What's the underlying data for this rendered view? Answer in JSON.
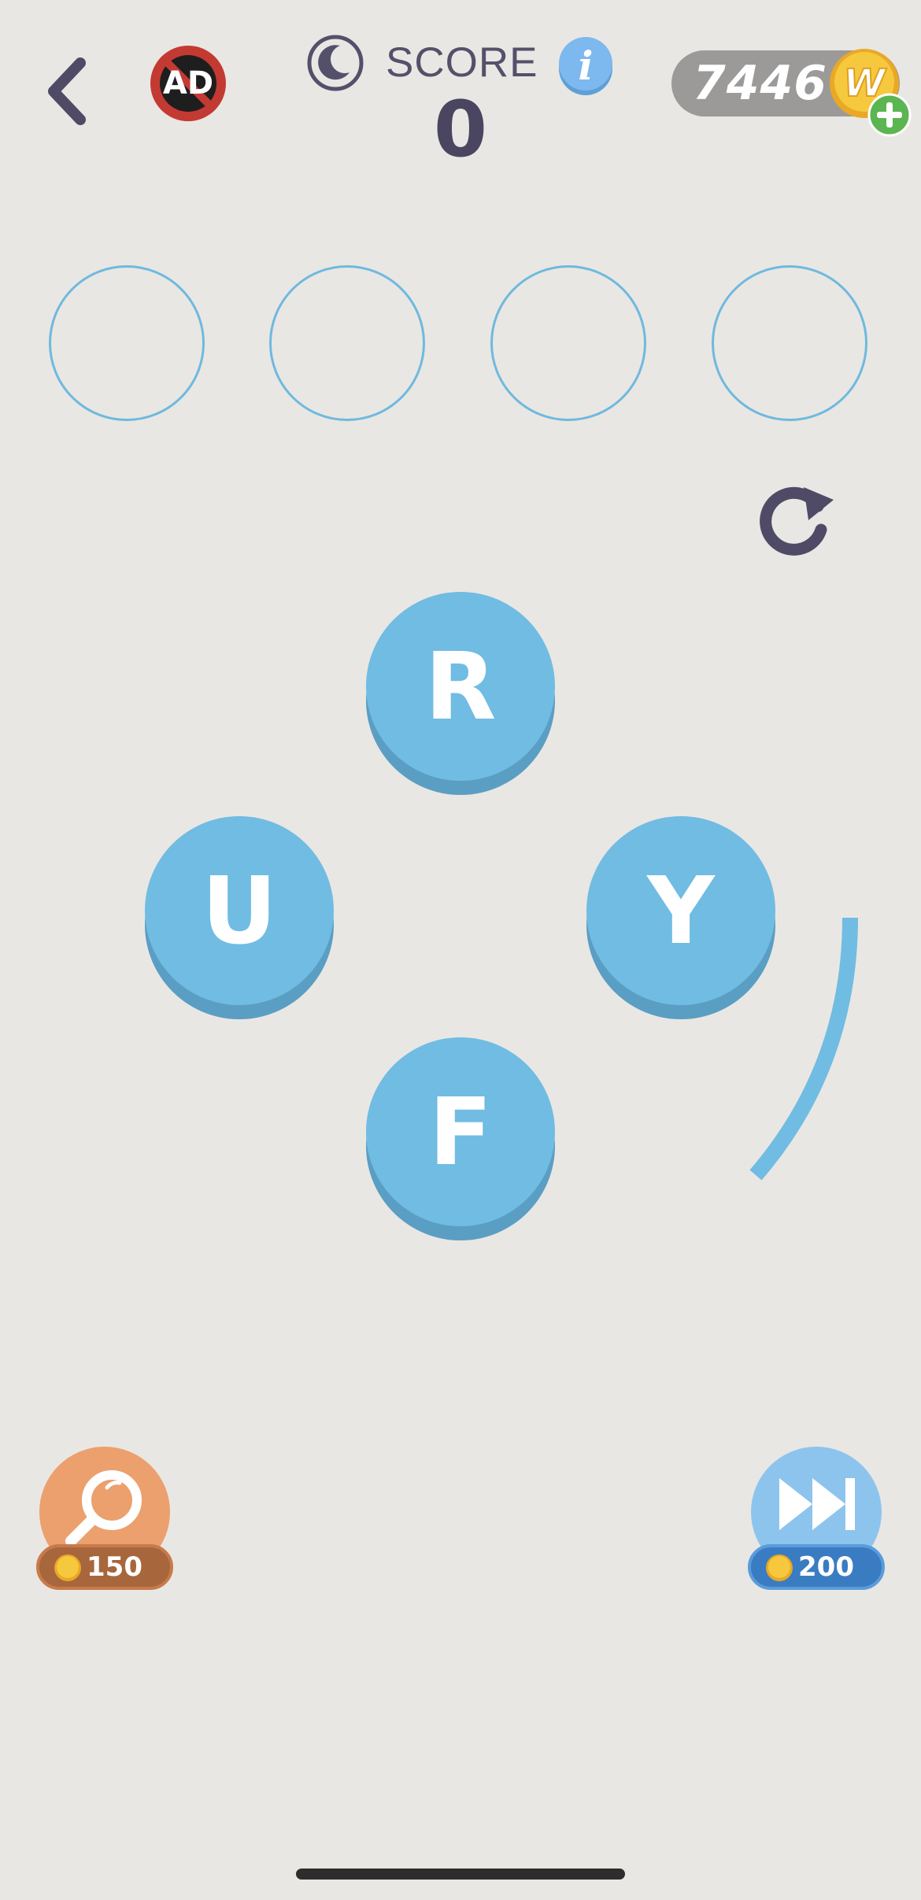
{
  "header": {
    "score_label": "SCORE",
    "score_value": "0",
    "coin_balance": "7446",
    "no_ads_label": "AD",
    "coin_symbol": "W"
  },
  "answer_slots": [
    "",
    "",
    "",
    ""
  ],
  "letters": [
    "R",
    "U",
    "Y",
    "F"
  ],
  "powerups": {
    "hint_cost": "150",
    "skip_cost": "200"
  },
  "colors": {
    "background": "#E9E7E3",
    "tile": "#70BCE3",
    "tile_shadow": "#5A9EC4",
    "slot_border": "#6FB9DF",
    "hint": "#EBA06D",
    "skip": "#8DC4EE",
    "text_dark": "#4A4560"
  }
}
